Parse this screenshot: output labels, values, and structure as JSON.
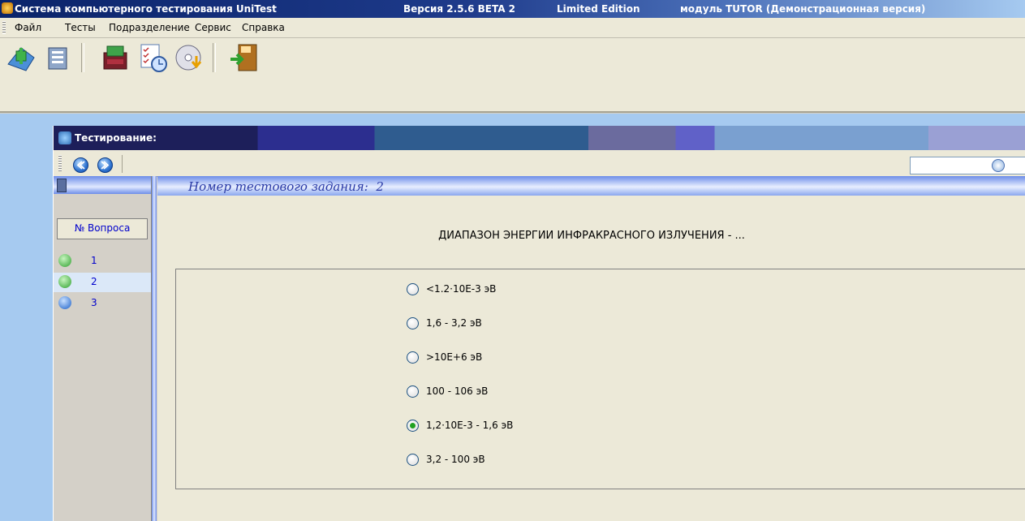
{
  "titlebar": {
    "app": "Система компьютерного тестирования UniTest",
    "version": "Версия 2.5.6 BETA 2",
    "edition": "Limited Edition",
    "module": "модуль TUTOR (Демонстрационная версия)"
  },
  "menu": [
    {
      "label": "Файл"
    },
    {
      "label": "Тесты"
    },
    {
      "label": "Подразделение"
    },
    {
      "label": "Сервис"
    },
    {
      "label": "Справка"
    }
  ],
  "toolbar": {
    "buttons": [
      "add-test-icon",
      "document-icon",
      "archive-icon",
      "checklist-clock-icon",
      "cd-download-icon",
      "exit-door-icon"
    ]
  },
  "window": {
    "title": "Тестирование:"
  },
  "questions_panel": {
    "column_header": "№ Вопроса",
    "items": [
      {
        "number": "1",
        "status": "answered"
      },
      {
        "number": "2",
        "status": "answered"
      },
      {
        "number": "3",
        "status": "unanswered"
      }
    ]
  },
  "task": {
    "label": "Номер тестового задания:",
    "number": "2",
    "question": "ДИАПАЗОН ЭНЕРГИИ ИНФРАКРАСНОГО ИЗЛУЧЕНИЯ - ...",
    "options": [
      {
        "text": "<1.2·10E-3 эВ",
        "selected": false
      },
      {
        "text": "1,6 - 3,2 эВ",
        "selected": false
      },
      {
        "text": ">10E+6 эВ",
        "selected": false
      },
      {
        "text": "100 - 106 эВ",
        "selected": false
      },
      {
        "text": "1,2·10E-3 - 1,6 эВ",
        "selected": true
      },
      {
        "text": "3,2 - 100 эВ",
        "selected": false
      }
    ]
  },
  "colors": {
    "accent_blue": "#0a246a",
    "workspace": "#a6caf0",
    "question_number": "#2a3aa6",
    "selected_radio": "#21a121"
  }
}
